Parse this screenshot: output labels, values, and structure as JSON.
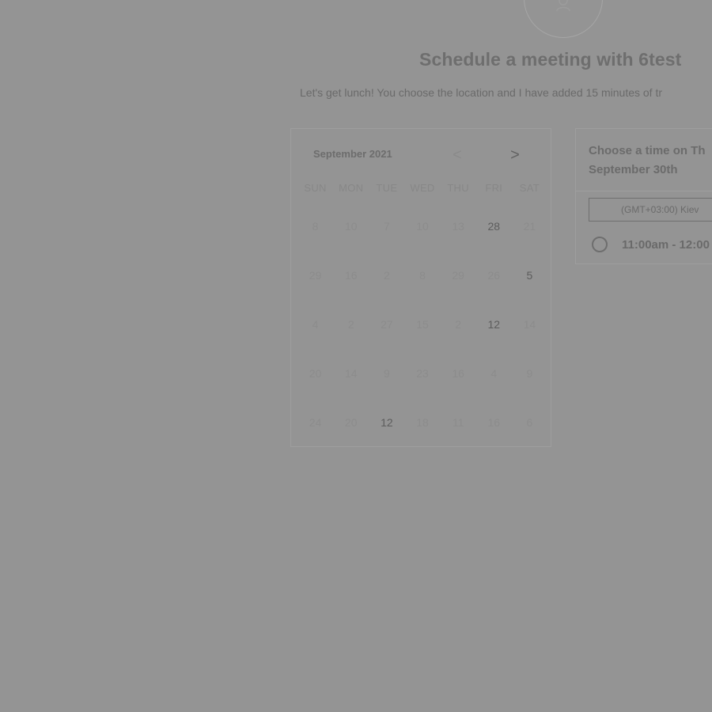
{
  "header": {
    "avatar_icon": "person-icon",
    "title": "Schedule a meeting with 6test",
    "description": "Let's get lunch! You choose the location and I have added 15 minutes of tr"
  },
  "calendar": {
    "month_label": "September 2021",
    "prev_icon": "<",
    "next_icon": ">",
    "weekdays": [
      "SUN",
      "MON",
      "TUE",
      "WED",
      "THU",
      "FRI",
      "SAT"
    ],
    "weeks": [
      [
        "8",
        "10",
        "7",
        "10",
        "13",
        "28",
        "21"
      ],
      [
        "29",
        "16",
        "2",
        "8",
        "29",
        "26",
        "5"
      ],
      [
        "4",
        "2",
        "27",
        "15",
        "2",
        "12",
        "14"
      ],
      [
        "20",
        "14",
        "9",
        "23",
        "16",
        "4",
        "9"
      ],
      [
        "24",
        "20",
        "12",
        "18",
        "11",
        "16",
        "6"
      ]
    ],
    "available_days": [
      "28",
      "5",
      "12 (FRI)",
      "12 (TUE)"
    ]
  },
  "time_picker": {
    "heading_line1": "Choose a time on Th",
    "heading_line2": "September 30th",
    "timezone": "(GMT+03:00) Kiev",
    "slots": [
      {
        "label": "11:00am - 12:00"
      }
    ]
  },
  "colors": {
    "overlay": "#949494",
    "text_dark": "#5d5d5d",
    "text_muted": "#8c8c8c"
  }
}
